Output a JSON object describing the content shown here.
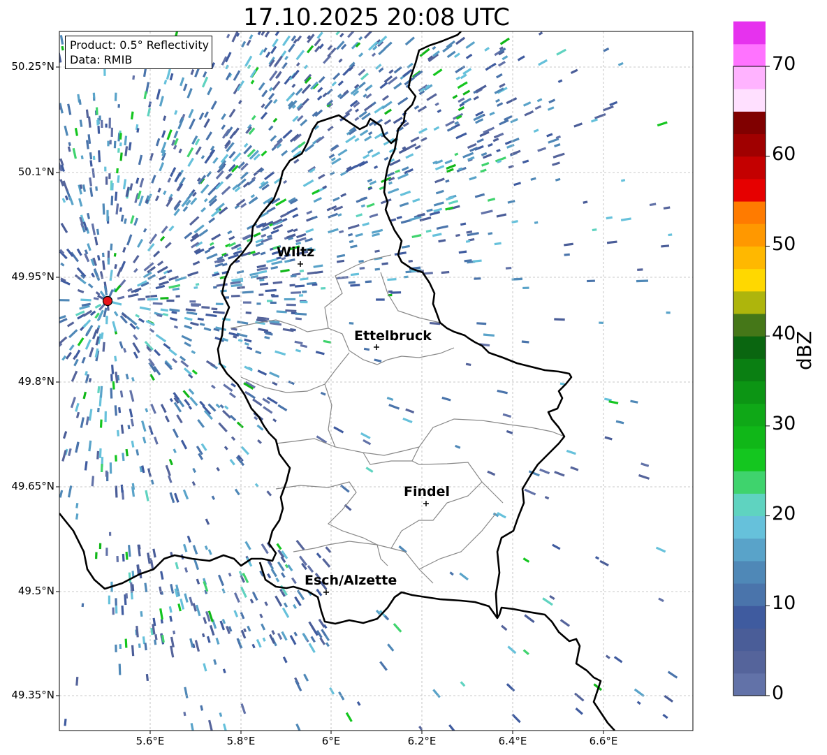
{
  "title": "17.10.2025 20:08 UTC",
  "info": {
    "product": "Product: 0.5° Reflectivity",
    "data": "Data: RMIB"
  },
  "axes": {
    "lat_ticks": [
      "50.25°N",
      "50.1°N",
      "49.95°N",
      "49.8°N",
      "49.65°N",
      "49.5°N",
      "49.35°N"
    ],
    "lon_ticks": [
      "5.6°E",
      "5.8°E",
      "6°E",
      "6.2°E",
      "6.4°E",
      "6.6°E"
    ]
  },
  "cities": [
    {
      "name": "Wiltz"
    },
    {
      "name": "Ettelbruck"
    },
    {
      "name": "Findel"
    },
    {
      "name": "Esch/Alzette"
    }
  ],
  "radar_site": {
    "color": "#e8141a"
  },
  "colorbar": {
    "label": "dBZ",
    "ticks": [
      "0",
      "10",
      "20",
      "30",
      "40",
      "50",
      "60",
      "70"
    ],
    "min": 0,
    "max": 70,
    "step": 2.5,
    "colors": [
      "#6272a8",
      "#55649b",
      "#4a5d98",
      "#3f5b9f",
      "#4a74ab",
      "#4f88b7",
      "#59a3c9",
      "#66c1db",
      "#5fd3c0",
      "#3fd36d",
      "#14c61f",
      "#10b718",
      "#0fa817",
      "#0c9514",
      "#0a7f12",
      "#0a6610",
      "#457718",
      "#aeb50c",
      "#ffd800",
      "#ffb800",
      "#ff9800",
      "#ff7b00",
      "#e60000",
      "#c40000",
      "#a00000",
      "#800000",
      "#ffe0ff",
      "#ffb3ff",
      "#ff73ff",
      "#e632ee"
    ]
  }
}
